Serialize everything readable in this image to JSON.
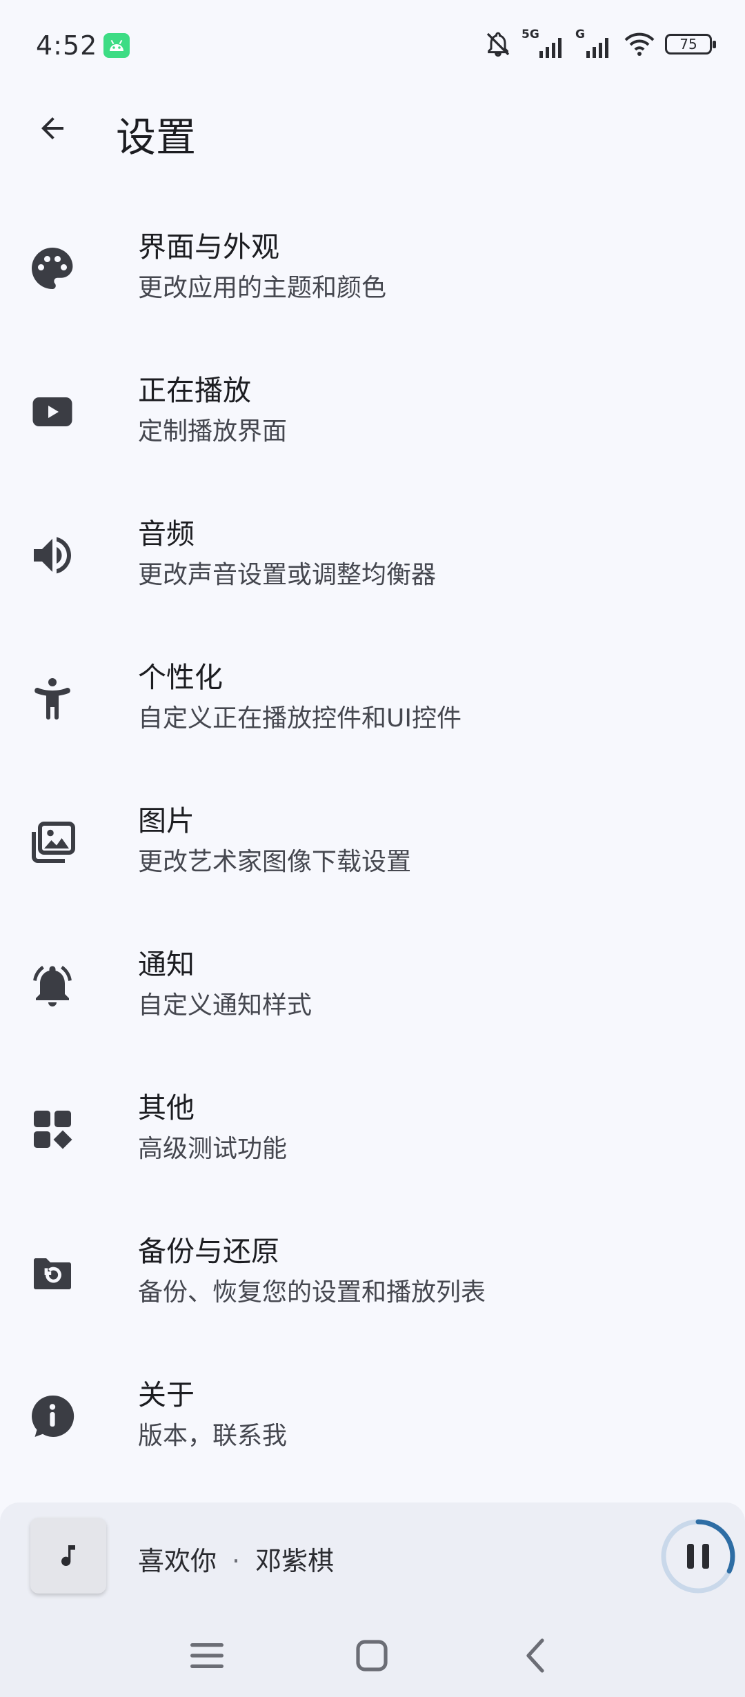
{
  "status_bar": {
    "time": "4:52",
    "network_1": "5G",
    "network_2": "G",
    "battery": "75"
  },
  "header": {
    "title": "设置"
  },
  "settings": [
    {
      "icon": "palette-icon",
      "title": "界面与外观",
      "subtitle": "更改应用的主题和颜色"
    },
    {
      "icon": "youtube-play-icon",
      "title": "正在播放",
      "subtitle": "定制播放界面"
    },
    {
      "icon": "volume-icon",
      "title": "音频",
      "subtitle": "更改声音设置或调整均衡器"
    },
    {
      "icon": "accessibility-person-icon",
      "title": "个性化",
      "subtitle": "自定义正在播放控件和UI控件"
    },
    {
      "icon": "image-icon",
      "title": "图片",
      "subtitle": "更改艺术家图像下载设置"
    },
    {
      "icon": "bell-icon",
      "title": "通知",
      "subtitle": "自定义通知样式"
    },
    {
      "icon": "widgets-icon",
      "title": "其他",
      "subtitle": "高级测试功能"
    },
    {
      "icon": "folder-restore-icon",
      "title": "备份与还原",
      "subtitle": "备份、恢复您的设置和播放列表"
    },
    {
      "icon": "info-icon",
      "title": "关于",
      "subtitle": "版本，联系我"
    }
  ],
  "mini_player": {
    "song": "喜欢你",
    "separator": "·",
    "artist": "邓紫棋",
    "progress": 0.32,
    "accent": "#2e6da4"
  },
  "colors": {
    "background": "#f7f8fd",
    "icon": "#3b3d44",
    "subtitle": "#45474f"
  }
}
